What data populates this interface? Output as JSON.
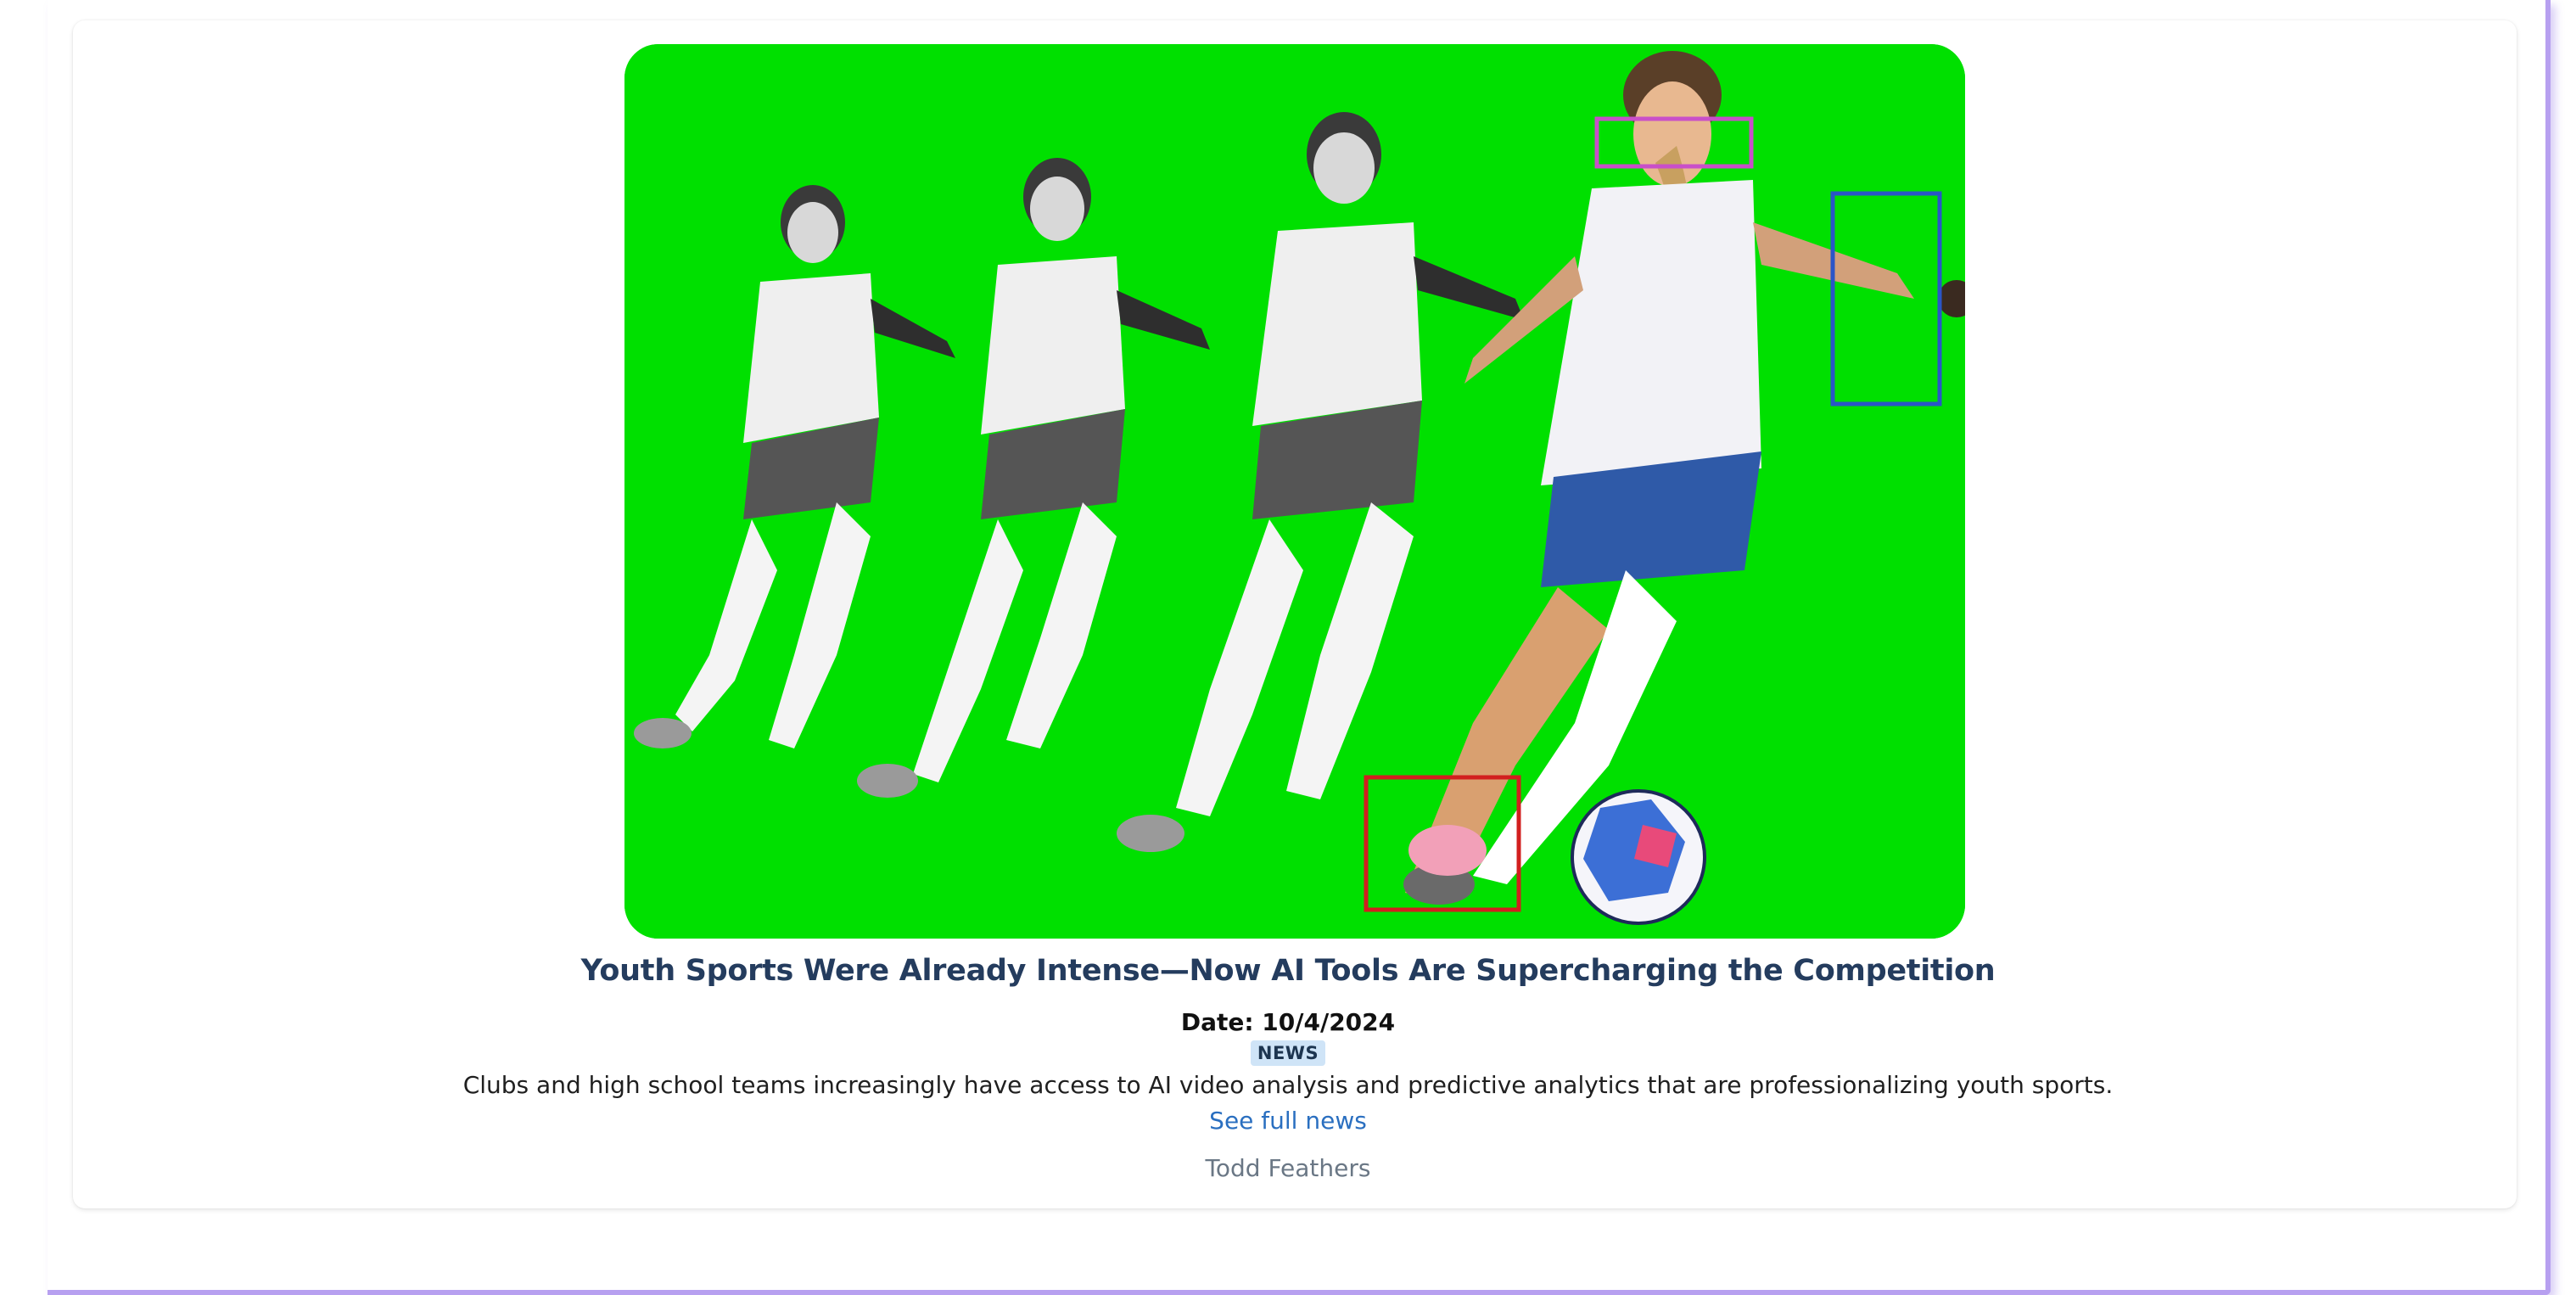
{
  "article": {
    "title": "Youth Sports Were Already Intense—Now AI Tools Are Supercharging the Competition",
    "date_label": "Date: 10/4/2024",
    "category": "NEWS",
    "summary": "Clubs and high school teams increasingly have access to AI video analysis and predictive analytics that are professionalizing youth sports.",
    "link_label": "See full news",
    "author": "Todd Feathers"
  },
  "image": {
    "subject": "soccer-player-motion-sequence",
    "background_color": "#00e000",
    "detection_boxes": [
      {
        "name": "face-detection-box",
        "color": "#c94fc9"
      },
      {
        "name": "hand-detection-box",
        "color": "#2a55c8"
      },
      {
        "name": "foot-detection-box",
        "color": "#d21f1f"
      }
    ]
  },
  "colors": {
    "title": "#243c5e",
    "link": "#2a6fc0",
    "badge_bg": "#cfe4f7",
    "panel_edge": "#b7a0f0"
  }
}
